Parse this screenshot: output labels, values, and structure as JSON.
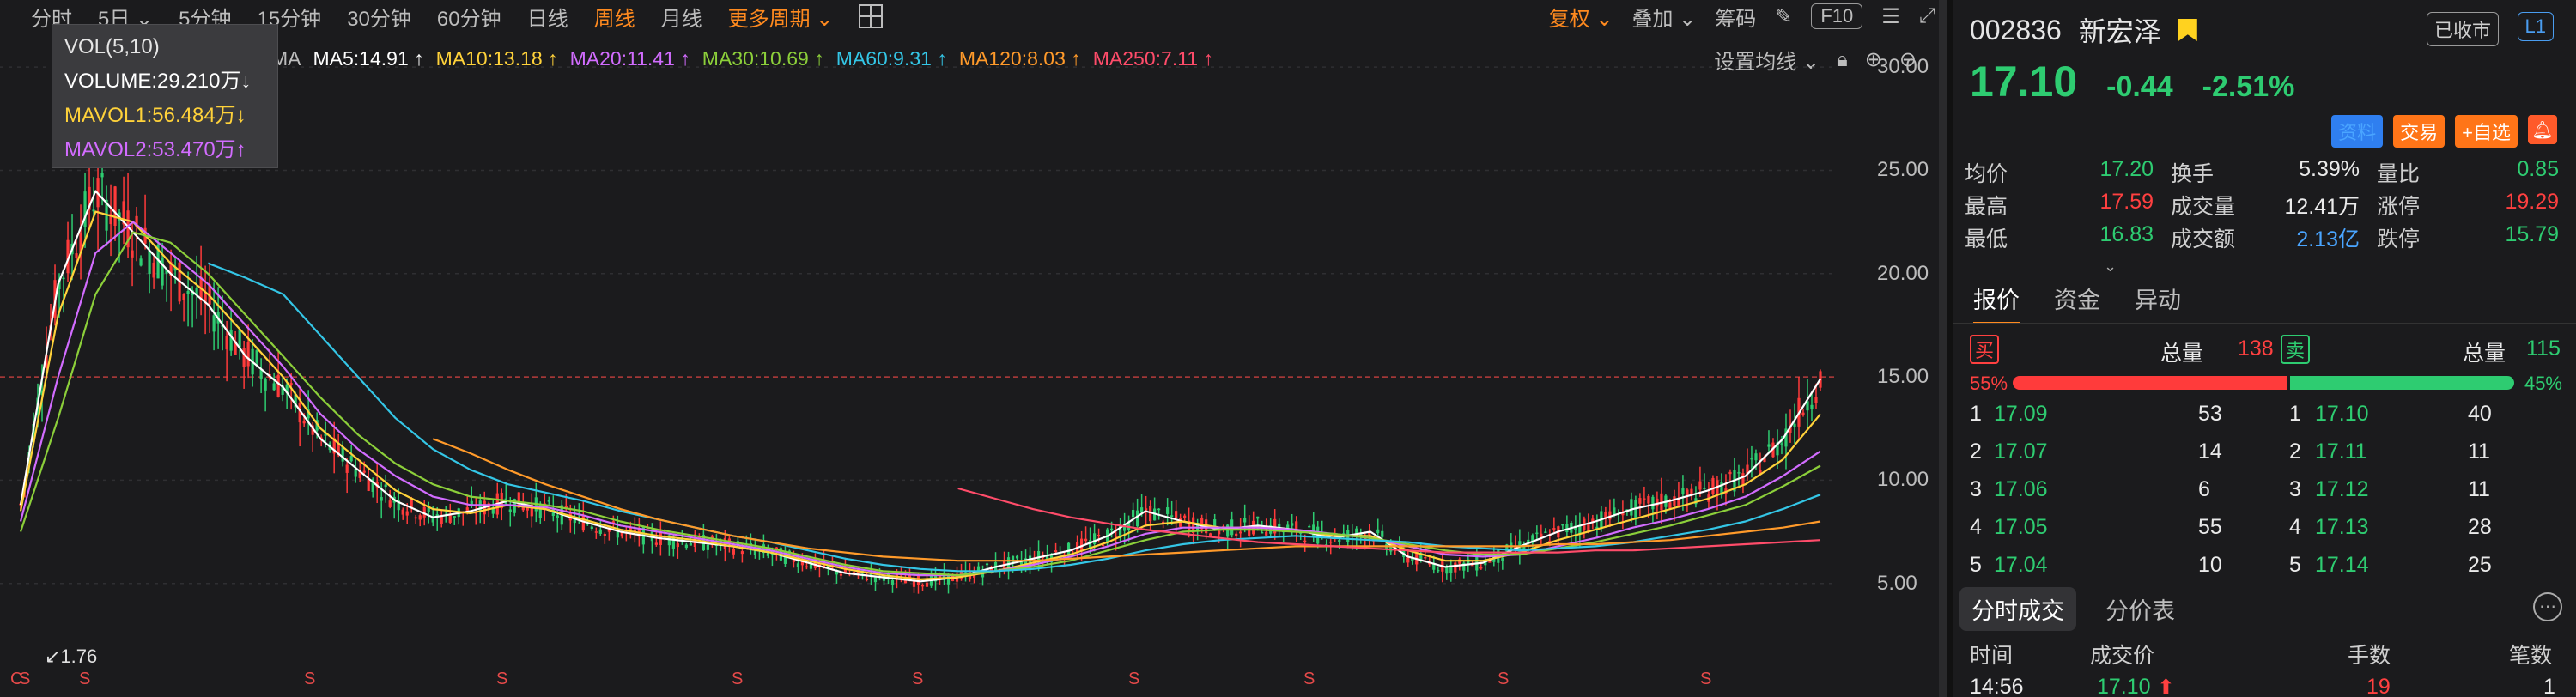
{
  "period_bar": {
    "tabs": [
      "分时",
      "5日",
      "5分钟",
      "15分钟",
      "30分钟",
      "60分钟",
      "日线",
      "周线",
      "月线"
    ],
    "active": "周线",
    "more": "更多周期"
  },
  "toolbar": {
    "fuquan": "复权",
    "overlay": "叠加",
    "chips": "筹码",
    "f10": "F10"
  },
  "ma_bar": {
    "prefix": "MA",
    "items": [
      {
        "label": "MA5:14.91 ↑",
        "color": "#ffffff"
      },
      {
        "label": "MA10:13.18 ↑",
        "color": "#ffd23a"
      },
      {
        "label": "MA20:11.41 ↑",
        "color": "#d26cff"
      },
      {
        "label": "MA30:10.69 ↑",
        "color": "#8ccf3a"
      },
      {
        "label": "MA60:9.31 ↑",
        "color": "#34c6e6"
      },
      {
        "label": "MA120:8.03 ↑",
        "color": "#ff9a2a"
      },
      {
        "label": "MA250:7.11 ↑",
        "color": "#ff4c6a"
      }
    ],
    "settings": "设置均线"
  },
  "vol_tooltip": {
    "title": "VOL(5,10)",
    "volume": "VOLUME:29.210万↓",
    "mavol1": "MAVOL1:56.484万↓",
    "mavol2": "MAVOL2:53.470万↑"
  },
  "chart_data": {
    "type": "line",
    "ylim": [
      0,
      32
    ],
    "yticks": [
      "30.00",
      "25.00",
      "20.00",
      "15.00",
      "10.00",
      "5.00"
    ],
    "ytick_values": [
      30,
      25,
      20,
      15,
      10,
      5
    ],
    "current_price": 15.0,
    "low_label": "1.76",
    "low_value": 1.76,
    "markers": [
      "C",
      "S",
      "S",
      "S",
      "S",
      "S",
      "S",
      "S",
      "S",
      "S",
      "S"
    ],
    "x": [
      0,
      10,
      20,
      30,
      40,
      50,
      60,
      70,
      80,
      90,
      100,
      110,
      120,
      130,
      140,
      150,
      160,
      170,
      180,
      190,
      200,
      210,
      220,
      230,
      240,
      250,
      260,
      270,
      280,
      290,
      300,
      310,
      320,
      330,
      340,
      350,
      360,
      370,
      380,
      390,
      400,
      410,
      420,
      430,
      440,
      450,
      460,
      470,
      480
    ],
    "series": [
      {
        "name": "MA5",
        "color": "#ffffff",
        "values": [
          8.8,
          19.5,
          24,
          22,
          20,
          18.5,
          16,
          14.5,
          12,
          10.5,
          9,
          8.2,
          8.5,
          9,
          8.6,
          8,
          7.5,
          7.2,
          7,
          6.8,
          6.5,
          6,
          5.5,
          5.3,
          5.1,
          5.3,
          5.8,
          6.2,
          6.6,
          7.3,
          8.5,
          8,
          7.6,
          7.8,
          7.6,
          7.2,
          7.5,
          6.3,
          5.8,
          6,
          6.8,
          7.5,
          8,
          8.6,
          9,
          9.5,
          10.2,
          12,
          14.9
        ]
      },
      {
        "name": "MA10",
        "color": "#ffd23a",
        "values": [
          8.5,
          18,
          23,
          22.5,
          20.5,
          19,
          17,
          15,
          12.5,
          11,
          9.5,
          8.6,
          8.4,
          8.8,
          8.6,
          8.1,
          7.6,
          7.3,
          7.1,
          6.8,
          6.5,
          6.1,
          5.7,
          5.4,
          5.2,
          5.3,
          5.6,
          6,
          6.4,
          7,
          7.8,
          8,
          7.7,
          7.7,
          7.6,
          7.3,
          7.3,
          6.6,
          6.1,
          6.1,
          6.5,
          7.1,
          7.6,
          8.1,
          8.6,
          9.1,
          9.8,
          11,
          13.2
        ]
      },
      {
        "name": "MA20",
        "color": "#d26cff",
        "values": [
          8,
          15,
          21,
          22.5,
          21,
          19.5,
          17.5,
          15.5,
          13.2,
          11.5,
          10.2,
          9.2,
          8.8,
          8.8,
          8.7,
          8.3,
          7.8,
          7.5,
          7.2,
          6.9,
          6.6,
          6.2,
          5.8,
          5.5,
          5.4,
          5.4,
          5.6,
          5.9,
          6.3,
          6.8,
          7.4,
          7.7,
          7.7,
          7.7,
          7.6,
          7.4,
          7.2,
          6.8,
          6.4,
          6.3,
          6.4,
          6.8,
          7.2,
          7.7,
          8.1,
          8.6,
          9.2,
          10.2,
          11.4
        ]
      },
      {
        "name": "MA30",
        "color": "#8ccf3a",
        "values": [
          7.5,
          13,
          19,
          22,
          21.5,
          20,
          18,
          16,
          14,
          12.2,
          10.8,
          9.8,
          9.2,
          9,
          8.8,
          8.5,
          8,
          7.6,
          7.3,
          7,
          6.7,
          6.3,
          5.9,
          5.6,
          5.5,
          5.4,
          5.6,
          5.8,
          6.1,
          6.6,
          7.1,
          7.5,
          7.6,
          7.6,
          7.5,
          7.4,
          7.2,
          6.9,
          6.6,
          6.4,
          6.4,
          6.7,
          7,
          7.4,
          7.8,
          8.3,
          8.8,
          9.7,
          10.7
        ]
      },
      {
        "name": "MA60",
        "color": "#34c6e6",
        "values": [
          null,
          null,
          null,
          null,
          null,
          20.5,
          19.8,
          19,
          17,
          15,
          13,
          11.5,
          10.5,
          9.8,
          9.4,
          9,
          8.5,
          8.1,
          7.7,
          7.3,
          7,
          6.6,
          6.2,
          5.9,
          5.7,
          5.6,
          5.6,
          5.7,
          5.9,
          6.2,
          6.6,
          6.9,
          7.1,
          7.2,
          7.3,
          7.2,
          7.1,
          7,
          6.8,
          6.7,
          6.6,
          6.7,
          6.8,
          7,
          7.3,
          7.6,
          8,
          8.6,
          9.3
        ]
      },
      {
        "name": "MA120",
        "color": "#ff9a2a",
        "values": [
          null,
          null,
          null,
          null,
          null,
          null,
          null,
          null,
          null,
          null,
          null,
          12,
          11.3,
          10.5,
          9.8,
          9.2,
          8.6,
          8.1,
          7.7,
          7.3,
          7,
          6.7,
          6.5,
          6.3,
          6.2,
          6.1,
          6.1,
          6.1,
          6.2,
          6.3,
          6.4,
          6.5,
          6.6,
          6.7,
          6.8,
          6.8,
          6.8,
          6.8,
          6.8,
          6.8,
          6.8,
          6.9,
          6.9,
          7,
          7.1,
          7.3,
          7.5,
          7.7,
          8.0
        ]
      },
      {
        "name": "MA250",
        "color": "#ff4c6a",
        "values": [
          null,
          null,
          null,
          null,
          null,
          null,
          null,
          null,
          null,
          null,
          null,
          null,
          null,
          null,
          null,
          null,
          null,
          null,
          null,
          null,
          null,
          null,
          null,
          null,
          null,
          9.6,
          9.1,
          8.6,
          8.2,
          7.9,
          7.6,
          7.4,
          7.2,
          7.0,
          6.9,
          6.8,
          6.7,
          6.6,
          6.5,
          6.5,
          6.5,
          6.5,
          6.6,
          6.6,
          6.7,
          6.8,
          6.9,
          7.0,
          7.1
        ]
      }
    ]
  },
  "stock": {
    "code": "002836",
    "name": "新宏泽",
    "status": "已收市",
    "level": "L1",
    "price": "17.10",
    "change": "-0.44",
    "change_pct": "-2.51%"
  },
  "actions": [
    "资料",
    "交易",
    "+自选"
  ],
  "stats": [
    [
      {
        "l": "均价",
        "v": "17.20",
        "c": "green"
      },
      {
        "l": "换手",
        "v": "5.39%",
        "c": "white"
      },
      {
        "l": "量比",
        "v": "0.85",
        "c": "green"
      }
    ],
    [
      {
        "l": "最高",
        "v": "17.59",
        "c": "red"
      },
      {
        "l": "成交量",
        "v": "12.41万",
        "c": "white"
      },
      {
        "l": "涨停",
        "v": "19.29",
        "c": "red"
      }
    ],
    [
      {
        "l": "最低",
        "v": "16.83",
        "c": "green"
      },
      {
        "l": "成交额",
        "v": "2.13亿",
        "c": "blue"
      },
      {
        "l": "跌停",
        "v": "15.79",
        "c": "green"
      }
    ]
  ],
  "tabs": [
    "报价",
    "资金",
    "异动"
  ],
  "order_book": {
    "buy_tag": "买",
    "sell_tag": "卖",
    "total_label": "总量",
    "buy_total": "138",
    "sell_total": "115",
    "buy_pct": "55%",
    "sell_pct": "45%",
    "buy_ratio": 0.55,
    "bids": [
      {
        "lvl": "1",
        "price": "17.09",
        "vol": "53"
      },
      {
        "lvl": "2",
        "price": "17.07",
        "vol": "14"
      },
      {
        "lvl": "3",
        "price": "17.06",
        "vol": "6"
      },
      {
        "lvl": "4",
        "price": "17.05",
        "vol": "55"
      },
      {
        "lvl": "5",
        "price": "17.04",
        "vol": "10"
      }
    ],
    "asks": [
      {
        "lvl": "1",
        "price": "17.10",
        "vol": "40"
      },
      {
        "lvl": "2",
        "price": "17.11",
        "vol": "11"
      },
      {
        "lvl": "3",
        "price": "17.12",
        "vol": "11"
      },
      {
        "lvl": "4",
        "price": "17.13",
        "vol": "28"
      },
      {
        "lvl": "5",
        "price": "17.14",
        "vol": "25"
      }
    ]
  },
  "tape": {
    "tabs": [
      "分时成交",
      "分价表"
    ],
    "headers": [
      "时间",
      "成交价",
      "手数",
      "笔数"
    ],
    "rows": [
      {
        "time": "14:56",
        "price": "17.10",
        "vol": "19",
        "count": "1"
      }
    ]
  }
}
